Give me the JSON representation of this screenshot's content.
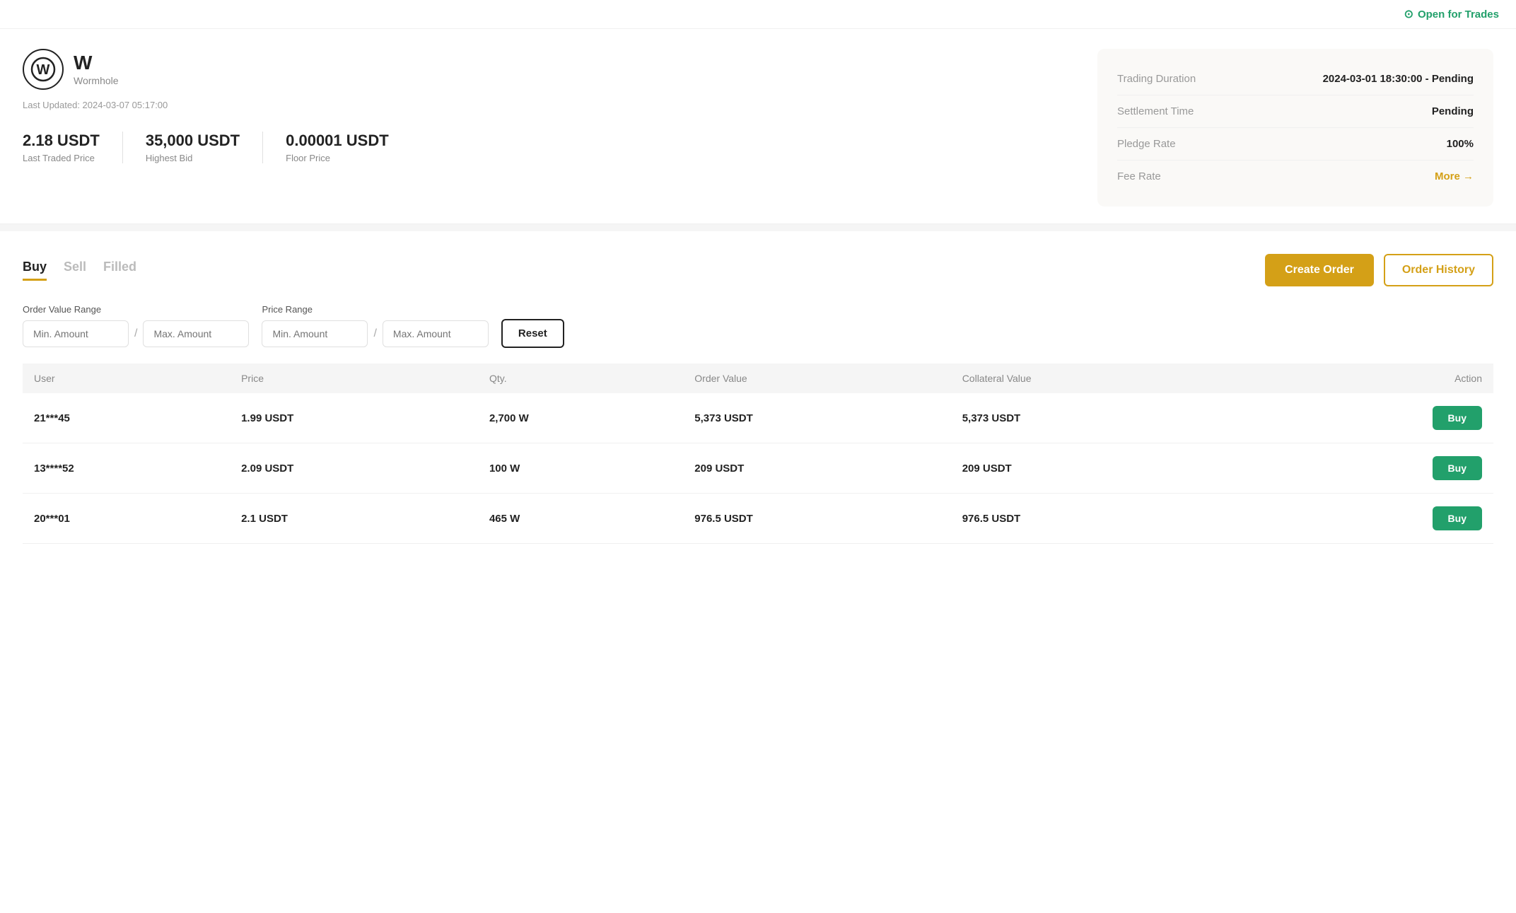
{
  "topBar": {
    "status": "Open for Trades",
    "statusIcon": "✓"
  },
  "asset": {
    "symbol": "W",
    "name": "Wormhole",
    "logo": "W",
    "lastUpdated": "Last Updated: 2024-03-07 05:17:00"
  },
  "prices": [
    {
      "value": "2.18 USDT",
      "label": "Last Traded Price"
    },
    {
      "value": "35,000 USDT",
      "label": "Highest Bid"
    },
    {
      "value": "0.00001 USDT",
      "label": "Floor Price"
    }
  ],
  "infoPanel": [
    {
      "key": "Trading Duration",
      "value": "2024-03-01 18:30:00 - Pending",
      "style": "normal"
    },
    {
      "key": "Settlement Time",
      "value": "Pending",
      "style": "normal"
    },
    {
      "key": "Pledge Rate",
      "value": "100%",
      "style": "normal"
    },
    {
      "key": "Fee Rate",
      "value": "More →",
      "style": "link"
    }
  ],
  "tabs": [
    {
      "label": "Buy",
      "active": true
    },
    {
      "label": "Sell",
      "active": false
    },
    {
      "label": "Filled",
      "active": false
    }
  ],
  "buttons": {
    "createOrder": "Create Order",
    "orderHistory": "Order History"
  },
  "filters": {
    "orderValueRange": "Order Value Range",
    "priceRange": "Price Range",
    "minAmountPlaceholder": "Min. Amount",
    "maxAmountPlaceholder": "Max. Amount",
    "resetLabel": "Reset"
  },
  "table": {
    "columns": [
      "User",
      "Price",
      "Qty.",
      "Order Value",
      "Collateral Value",
      "Action"
    ],
    "rows": [
      {
        "user": "21***45",
        "price": "1.99 USDT",
        "qty": "2,700 W",
        "orderValue": "5,373 USDT",
        "collateral": "5,373 USDT",
        "action": "Buy"
      },
      {
        "user": "13****52",
        "price": "2.09 USDT",
        "qty": "100 W",
        "orderValue": "209 USDT",
        "collateral": "209 USDT",
        "action": "Buy"
      },
      {
        "user": "20***01",
        "price": "2.1 USDT",
        "qty": "465 W",
        "orderValue": "976.5 USDT",
        "collateral": "976.5 USDT",
        "action": "Buy"
      }
    ]
  }
}
